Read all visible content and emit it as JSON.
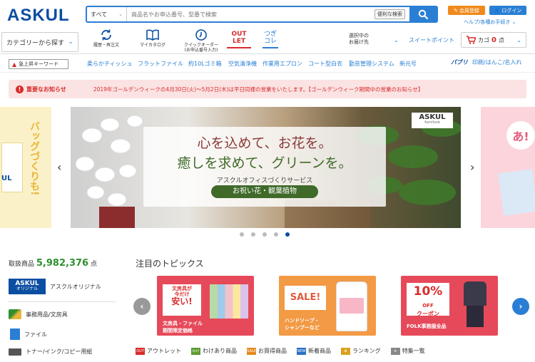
{
  "header": {
    "logo": "ASKUL",
    "search_scope": "すべて",
    "search_placeholder": "商品名やお申込番号、型番で検索",
    "convenient_search": "便利な検索",
    "member_register": "会員登録",
    "login": "ログイン",
    "help": "ヘルプ/各種お手続き"
  },
  "nav": {
    "category": "カテゴリーから探す",
    "items": [
      {
        "label": "履歴・再注文"
      },
      {
        "label": "マイカタログ"
      },
      {
        "label": "クイックオーダー (お申込番号入力)"
      }
    ],
    "outlet_1": "OUT",
    "outlet_2": "LET",
    "tsugi_1": "つぎ",
    "tsugi_2": "コレ",
    "delivery_1": "選択中の",
    "delivery_2": "お届け先",
    "sweet_point": "スイートポイント",
    "cart_label": "カゴ",
    "cart_count": "0",
    "cart_unit": "点"
  },
  "keywords": {
    "label": "急上昇キーワード",
    "items": [
      "柔らかティッシュ",
      "フラットファイル",
      "約10Lゴミ箱",
      "空気清浄機",
      "作業用エプロン",
      "コート型白衣",
      "勤怠管理システム",
      "新元号"
    ],
    "publi_logo": "パブリ",
    "publi_text": "印刷/はんこ/名入れ"
  },
  "notice": {
    "tag": "重要なお知らせ",
    "text": "2019年ゴールデンウィークの4月30日(火)〜5月2日(木)は平日同様の営業をいたします。【ゴールデンウィーク期間中の営業のお知らせ】"
  },
  "banner": {
    "line1": "心を込めて、お花を。",
    "line2": "癒しを求めて、グリーンを。",
    "sub": "アスクルオフィスづくりサービス",
    "pill": "お祝い花・観葉植物",
    "badge_1": "ASKUL",
    "badge_2": "furniture",
    "left_text": "バッグづくりも!",
    "left_logo": "UL",
    "right_text": "あ!"
  },
  "stats": {
    "label": "取扱商品",
    "count": "5,982,376",
    "unit": "点"
  },
  "sidebar": {
    "items": [
      {
        "label": "アスクルオリジナル",
        "logo_1": "ASKUL",
        "logo_2": "オリジナル"
      },
      {
        "label": "事務用品/文房具"
      },
      {
        "label": "ファイル"
      },
      {
        "label": "トナー/インク/コピー用紙"
      }
    ]
  },
  "topics": {
    "title": "注目のトピックス",
    "cards": [
      {
        "badge_1": "文房具が",
        "badge_2": "今だけ",
        "badge_3": "安い!",
        "caption_1": "文房具・ファイル",
        "caption_2": "期間限定価格"
      },
      {
        "badge": "SALE!",
        "caption_1": "ハンドソープ・",
        "caption_2": "シャンプーなど"
      },
      {
        "badge_1": "10%",
        "badge_2": "OFF",
        "badge_3": "クーポン",
        "caption": "FOLK事務服全品"
      }
    ]
  },
  "quick_links": [
    {
      "tag": "OUT LET",
      "label": "アウトレット",
      "color": "#d92b2b"
    },
    {
      "tag": "わけ",
      "label": "わけあり商品",
      "color": "#5a9a2f"
    },
    {
      "tag": "SALE",
      "label": "お買得商品",
      "color": "#e58a1f"
    },
    {
      "tag": "NEW",
      "label": "新着商品",
      "color": "#2a6fc4"
    },
    {
      "tag": "♛",
      "label": "ランキング",
      "color": "#d9a11f"
    },
    {
      "tag": "≡",
      "label": "特集一覧",
      "color": "#888888"
    }
  ],
  "colors": {
    "brand": "#0b4ea2",
    "accent": "#2a7fd4",
    "orange": "#f08a1c",
    "red": "#d92b2b"
  }
}
